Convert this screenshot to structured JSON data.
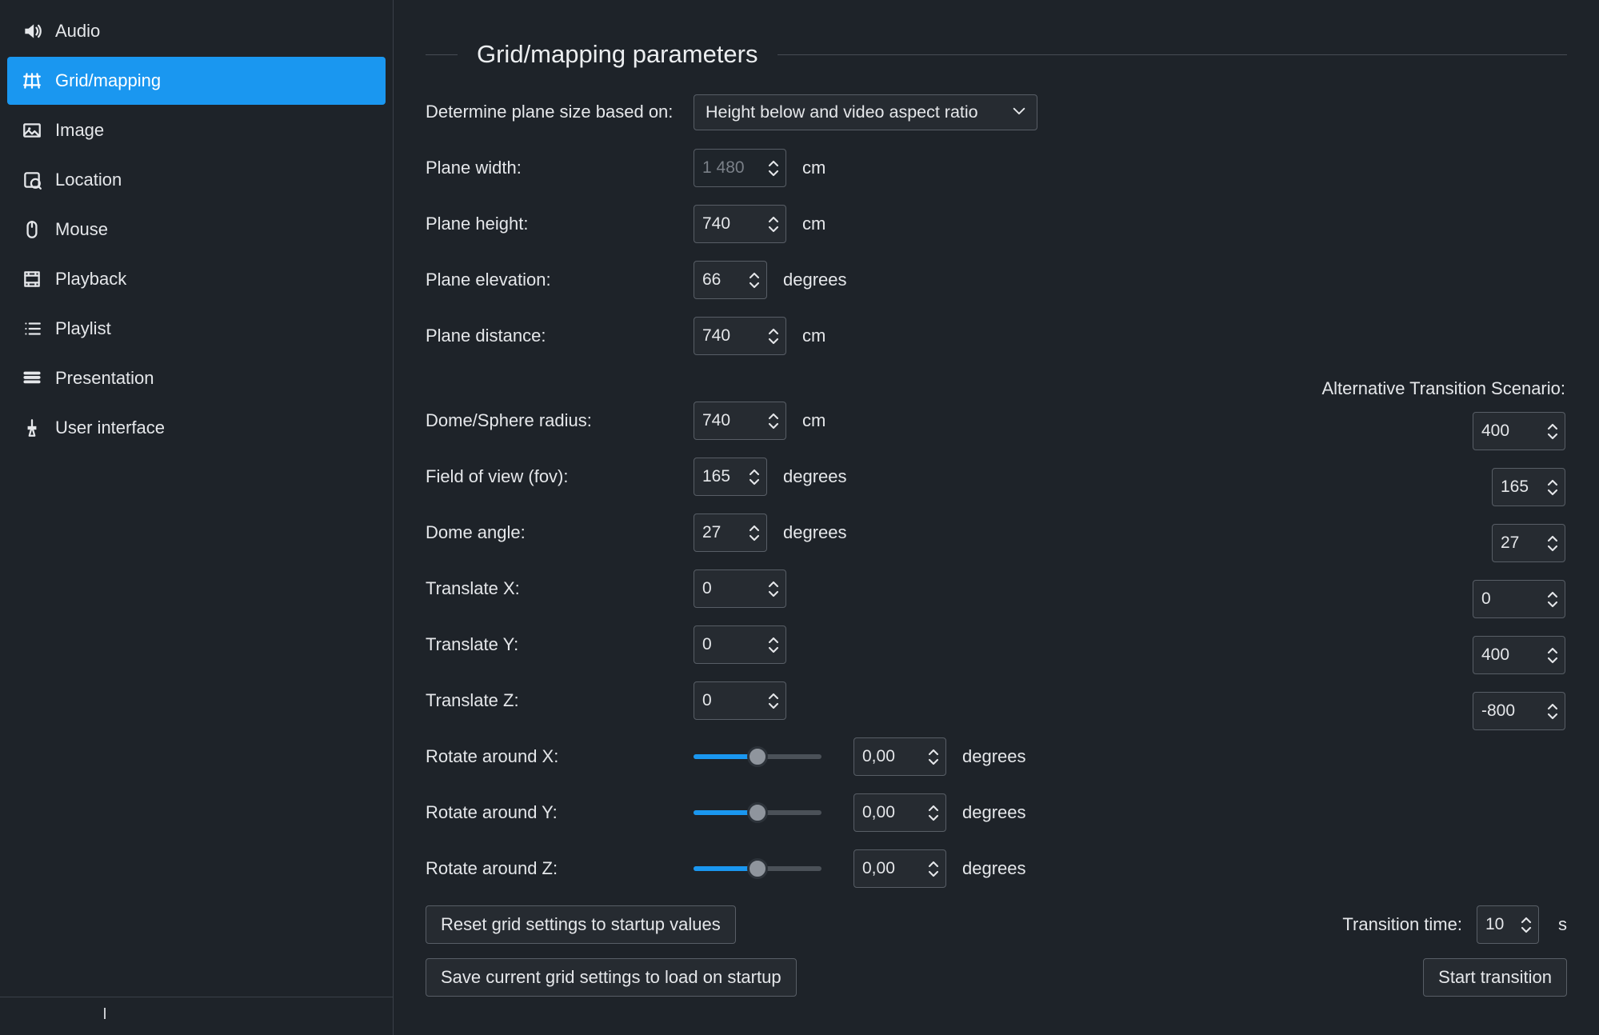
{
  "sidebar": {
    "items": [
      {
        "label": "Audio"
      },
      {
        "label": "Grid/mapping"
      },
      {
        "label": "Image"
      },
      {
        "label": "Location"
      },
      {
        "label": "Mouse"
      },
      {
        "label": "Playback"
      },
      {
        "label": "Playlist"
      },
      {
        "label": "Presentation"
      },
      {
        "label": "User interface"
      }
    ],
    "active_index": 1
  },
  "header": {
    "title": "Grid/mapping parameters"
  },
  "form": {
    "plane_size_basis": {
      "label": "Determine plane size based on:",
      "value": "Height below and video aspect ratio"
    },
    "plane_width": {
      "label": "Plane width:",
      "value": "1 480",
      "unit": "cm",
      "disabled": true
    },
    "plane_height": {
      "label": "Plane height:",
      "value": "740",
      "unit": "cm"
    },
    "plane_elevation": {
      "label": "Plane elevation:",
      "value": "66",
      "unit": "degrees"
    },
    "plane_distance": {
      "label": "Plane distance:",
      "value": "740",
      "unit": "cm"
    },
    "dome_radius": {
      "label": "Dome/Sphere radius:",
      "value": "740",
      "unit": "cm"
    },
    "fov": {
      "label": "Field of view (fov):",
      "value": "165",
      "unit": "degrees"
    },
    "dome_angle": {
      "label": "Dome angle:",
      "value": "27",
      "unit": "degrees"
    },
    "translate_x": {
      "label": "Translate X:",
      "value": "0"
    },
    "translate_y": {
      "label": "Translate Y:",
      "value": "0"
    },
    "translate_z": {
      "label": "Translate Z:",
      "value": "0"
    },
    "rotate_x": {
      "label": "Rotate around X:",
      "value": "0,00",
      "unit": "degrees",
      "slider_pct": 50
    },
    "rotate_y": {
      "label": "Rotate around Y:",
      "value": "0,00",
      "unit": "degrees",
      "slider_pct": 50
    },
    "rotate_z": {
      "label": "Rotate around Z:",
      "value": "0,00",
      "unit": "degrees",
      "slider_pct": 50
    }
  },
  "alt": {
    "header": "Alternative Transition Scenario:",
    "dome_radius": "400",
    "fov": "165",
    "dome_angle": "27",
    "translate_x": "0",
    "translate_y": "400",
    "translate_z": "-800"
  },
  "buttons": {
    "reset": "Reset grid settings to startup values",
    "save": "Save current grid settings to load on startup",
    "start": "Start transition"
  },
  "transition": {
    "label": "Transition time:",
    "value": "10",
    "unit": "s"
  }
}
